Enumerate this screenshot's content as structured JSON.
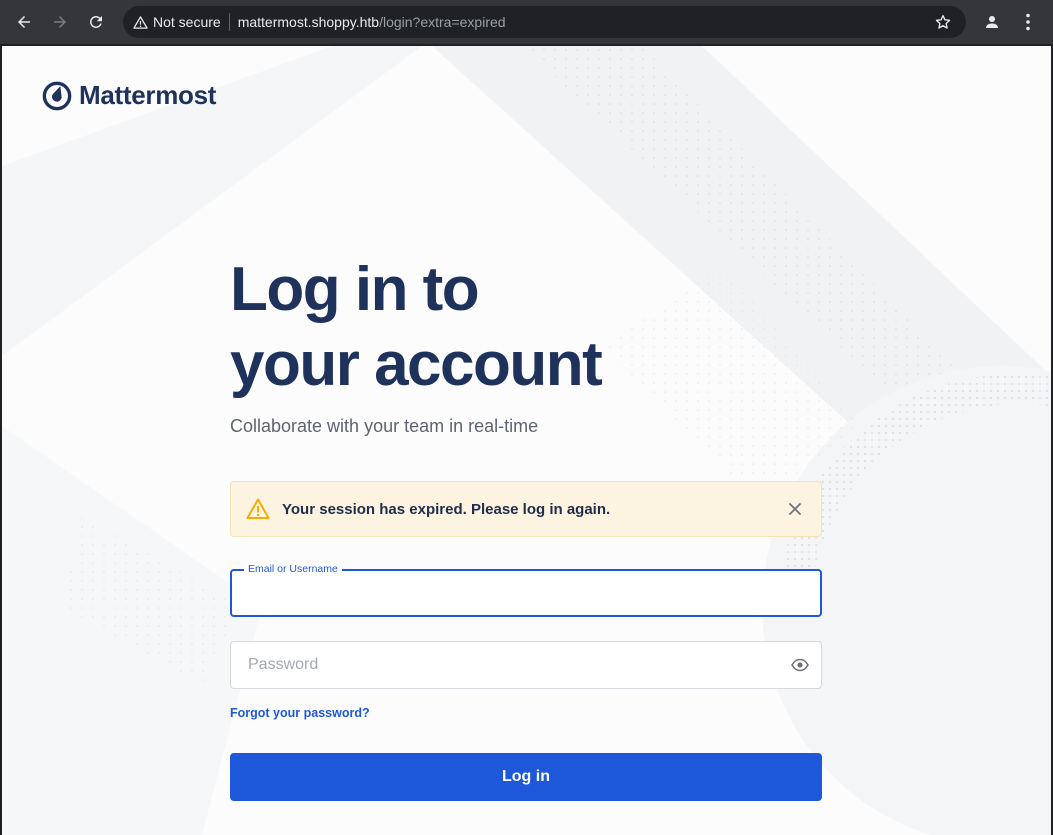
{
  "browser": {
    "security_label": "Not secure",
    "url_host": "mattermost.shoppy.htb",
    "url_path": "/login?extra=expired"
  },
  "brand": {
    "name": "Mattermost",
    "color": "#1e325c"
  },
  "hero": {
    "title_line1": "Log in to",
    "title_line2": "your account",
    "subtitle": "Collaborate with your team in real-time"
  },
  "alert": {
    "message": "Your session has expired. Please log in again.",
    "icon": "warning-icon",
    "background": "#fcf4e1"
  },
  "form": {
    "email_label": "Email or Username",
    "email_value": "",
    "password_placeholder": "Password",
    "password_value": "",
    "forgot_link": "Forgot your password?",
    "submit_label": "Log in",
    "accent_color": "#1c58d9"
  }
}
